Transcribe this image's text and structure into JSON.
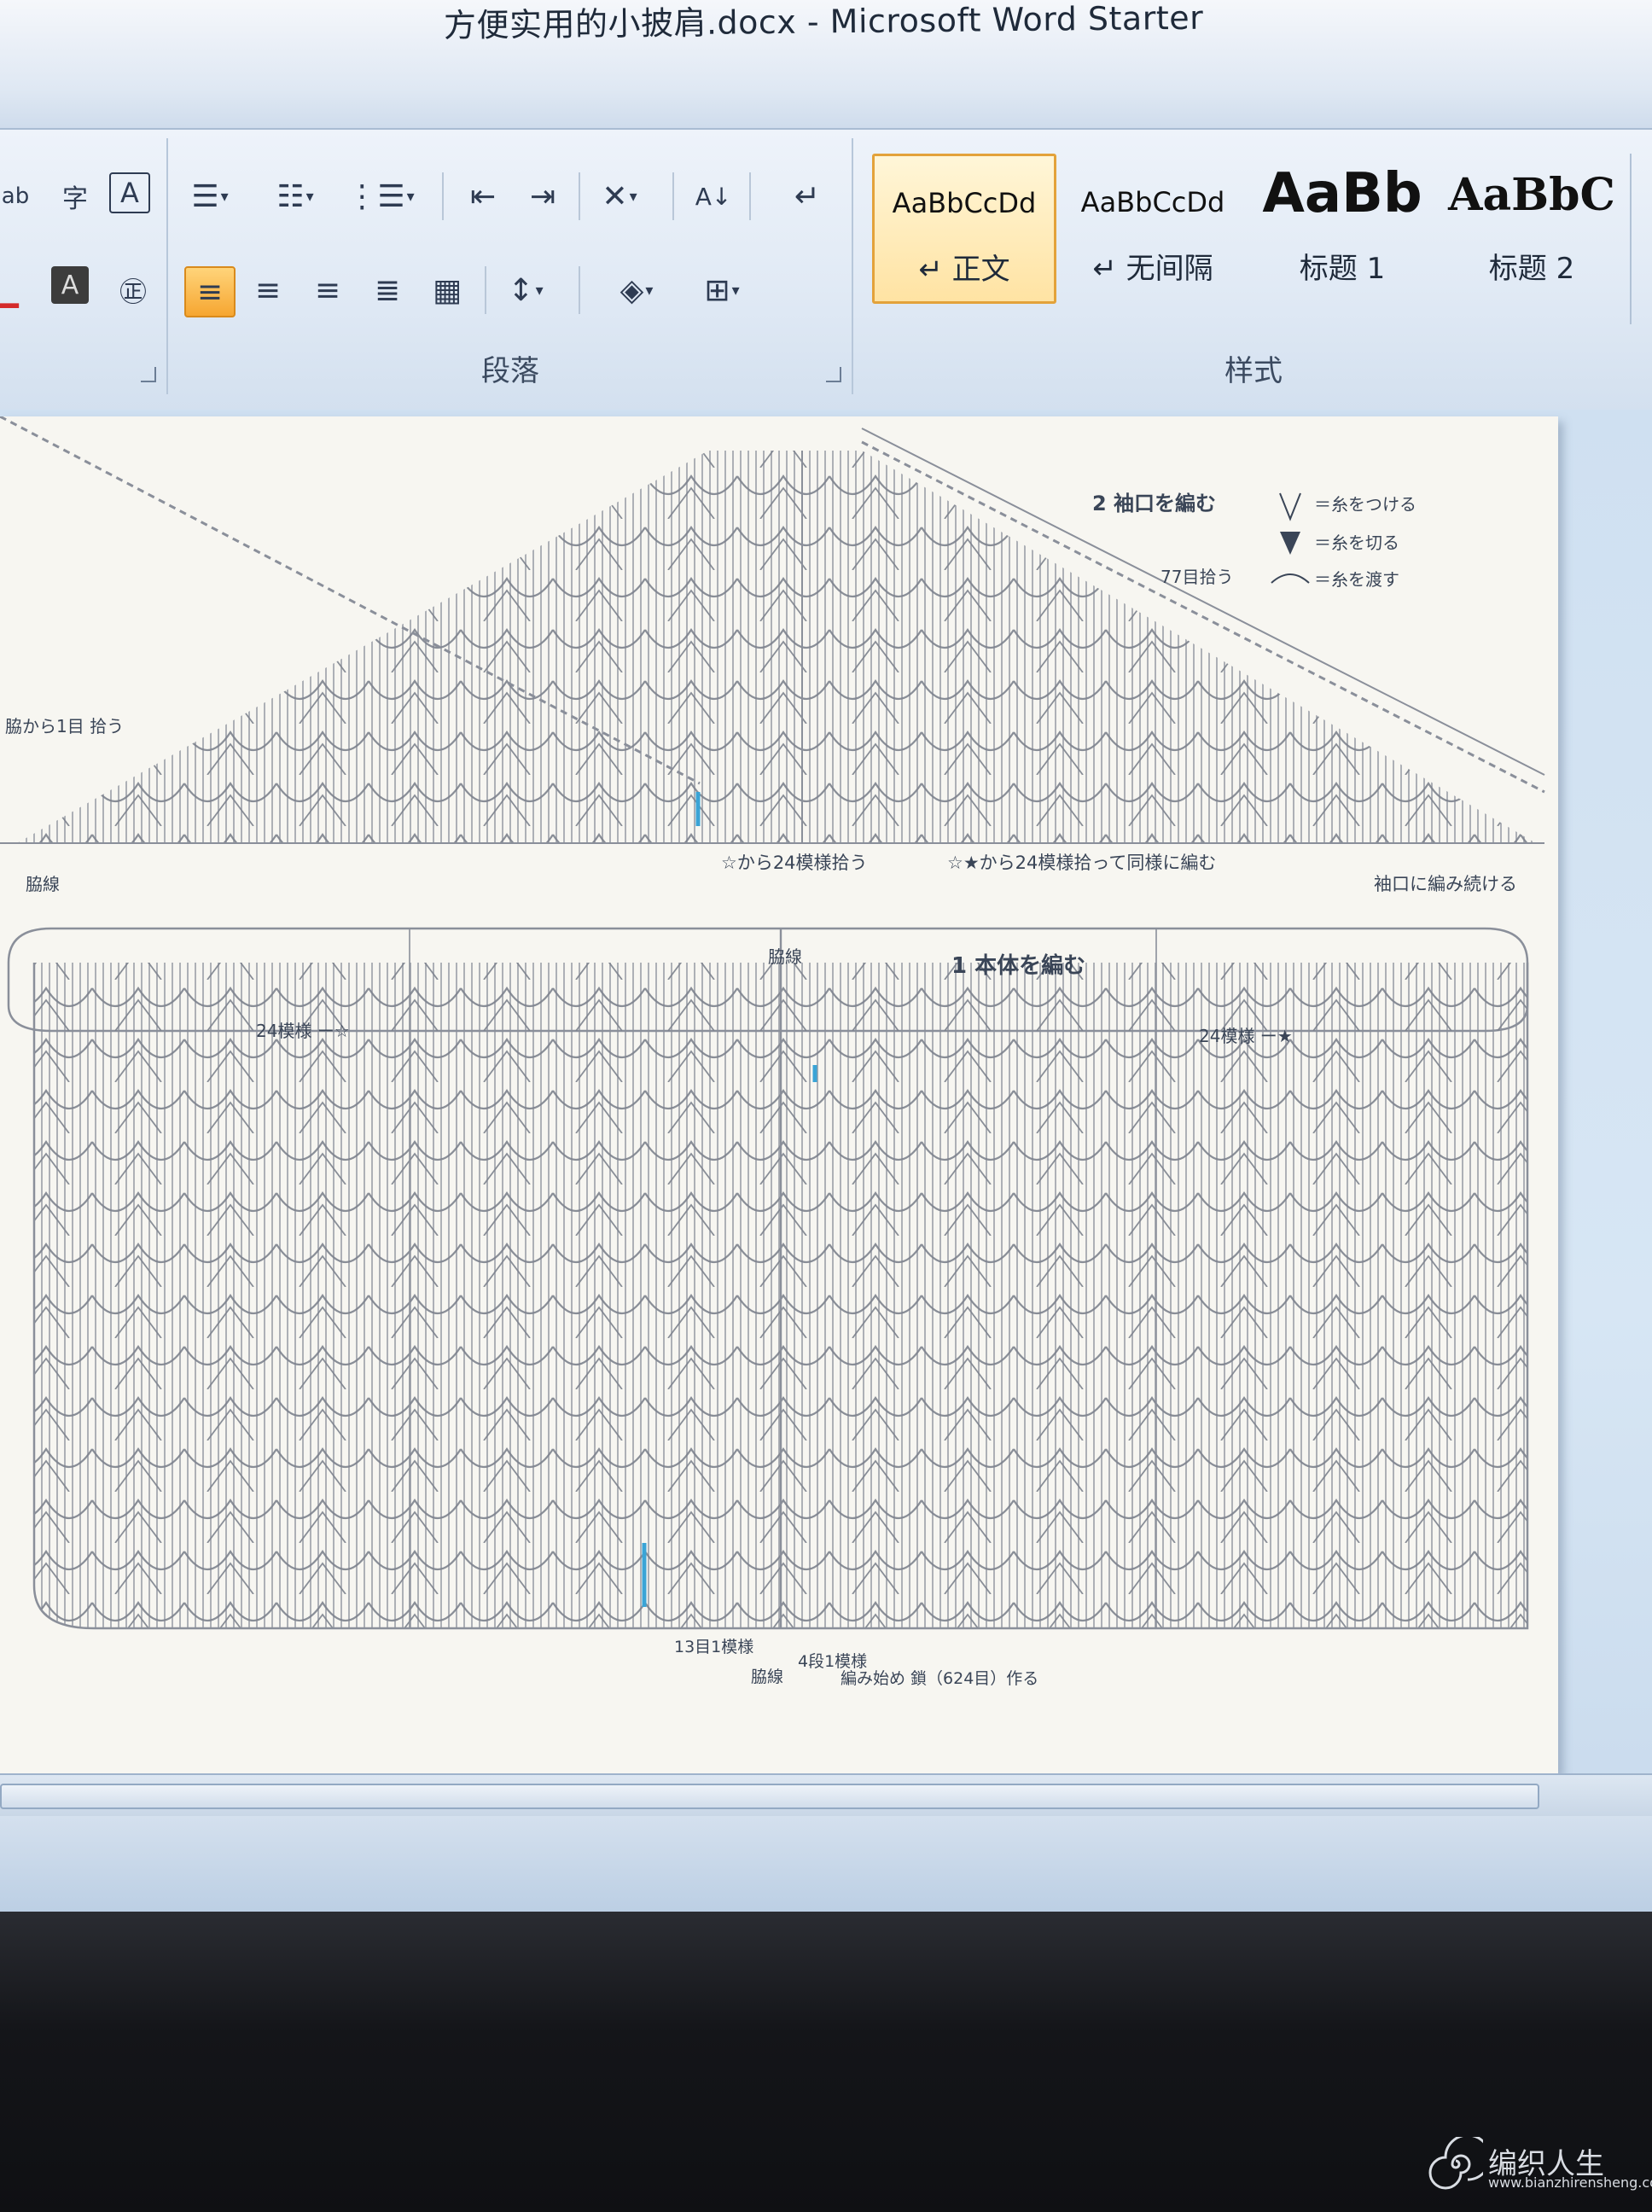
{
  "window": {
    "title": "方便实用的小披肩.docx  -  Microsoft Word Starter"
  },
  "ribbon": {
    "groups": {
      "font": {
        "label": ""
      },
      "paragraph": {
        "label": "段落"
      },
      "styles": {
        "label": "样式"
      }
    },
    "paragraph_buttons": [
      "bullets",
      "numbering",
      "multilevel-list",
      "decrease-indent",
      "increase-indent",
      "chinese-layout",
      "sort",
      "show-marks",
      "align-left",
      "align-center",
      "align-right",
      "justify",
      "distributed",
      "line-spacing",
      "shading",
      "borders"
    ],
    "styles": [
      {
        "sample": "AaBbCcDd",
        "name": "↵ 正文",
        "selected": true
      },
      {
        "sample": "AaBbCcDd",
        "name": "↵ 无间隔",
        "selected": false
      },
      {
        "sample": "AaBb",
        "name": "标题 1",
        "selected": false
      },
      {
        "sample": "AaBbC",
        "name": "标题 2",
        "selected": false
      }
    ]
  },
  "document": {
    "chart_labels": {
      "sleeve_title": "2 袖口を編む",
      "legend_attach": "＝糸をつける",
      "legend_cut": "＝糸を切る",
      "legend_pass": "＝糸を渡す",
      "stitch_count": "77目拾う",
      "pick_from_side": "脇から1目\n拾う",
      "side_seam": "脇線",
      "pick_from_star_outline": "☆から24模様拾う",
      "pick_and_knit_same": "☆★から24模様拾って同様に編む",
      "continue_to_cuff": "袖口に編み続ける",
      "body_title": "1 本体を編む",
      "repeat_left": "24模様 ー☆",
      "repeat_right": "24模様 ー★",
      "side_seam_center": "脇線",
      "thirteen_st_repeat": "13目1模様",
      "four_row_repeat": "4段1模様",
      "start_chain": "編み始め 鎖（624目）作る",
      "side_seam_bottom": "脇線"
    },
    "colors": {
      "chart_line": "#8a8f9a",
      "accent_blue": "#3aa4d6"
    }
  },
  "watermark": {
    "brand": "编织人生",
    "url": "www.bianzhirensheng.com"
  }
}
